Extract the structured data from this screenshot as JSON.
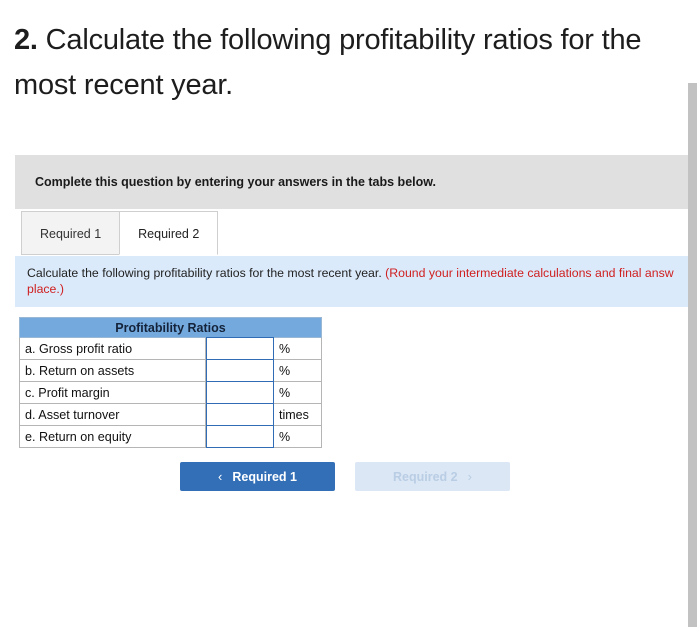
{
  "question": {
    "number": "2.",
    "text": "Calculate the following profitability ratios for the most recent year."
  },
  "panel": {
    "complete_banner": "Complete this question by entering your answers in the tabs below."
  },
  "tabs": [
    {
      "label": "Required 1",
      "active": false
    },
    {
      "label": "Required 2",
      "active": true
    }
  ],
  "requirement": {
    "line1_plain": "Calculate the following profitability ratios for the most recent year. ",
    "line1_note": "(Round your intermediate calculations and final answ",
    "line2_note": "place.)"
  },
  "table": {
    "header": "Profitability Ratios",
    "rows": [
      {
        "label": "a. Gross profit ratio",
        "value": "",
        "unit": "%"
      },
      {
        "label": "b. Return on assets",
        "value": "",
        "unit": "%"
      },
      {
        "label": "c. Profit margin",
        "value": "",
        "unit": "%"
      },
      {
        "label": "d. Asset turnover",
        "value": "",
        "unit": "times"
      },
      {
        "label": "e. Return on equity",
        "value": "",
        "unit": "%"
      }
    ]
  },
  "nav": {
    "prev": {
      "label": "Required 1",
      "chevron": "‹",
      "state": "enabled"
    },
    "next": {
      "label": "Required 2",
      "chevron": "›",
      "state": "disabled"
    }
  },
  "colors": {
    "table_header_blue": "#74a9dd",
    "requirement_band_blue": "#dbeafb",
    "banner_gray": "#e0e0e0",
    "primary_button": "#336fb7",
    "disabled_button": "#dbe7f5",
    "note_red": "#cf2020",
    "input_border": "#2f6cb5"
  }
}
